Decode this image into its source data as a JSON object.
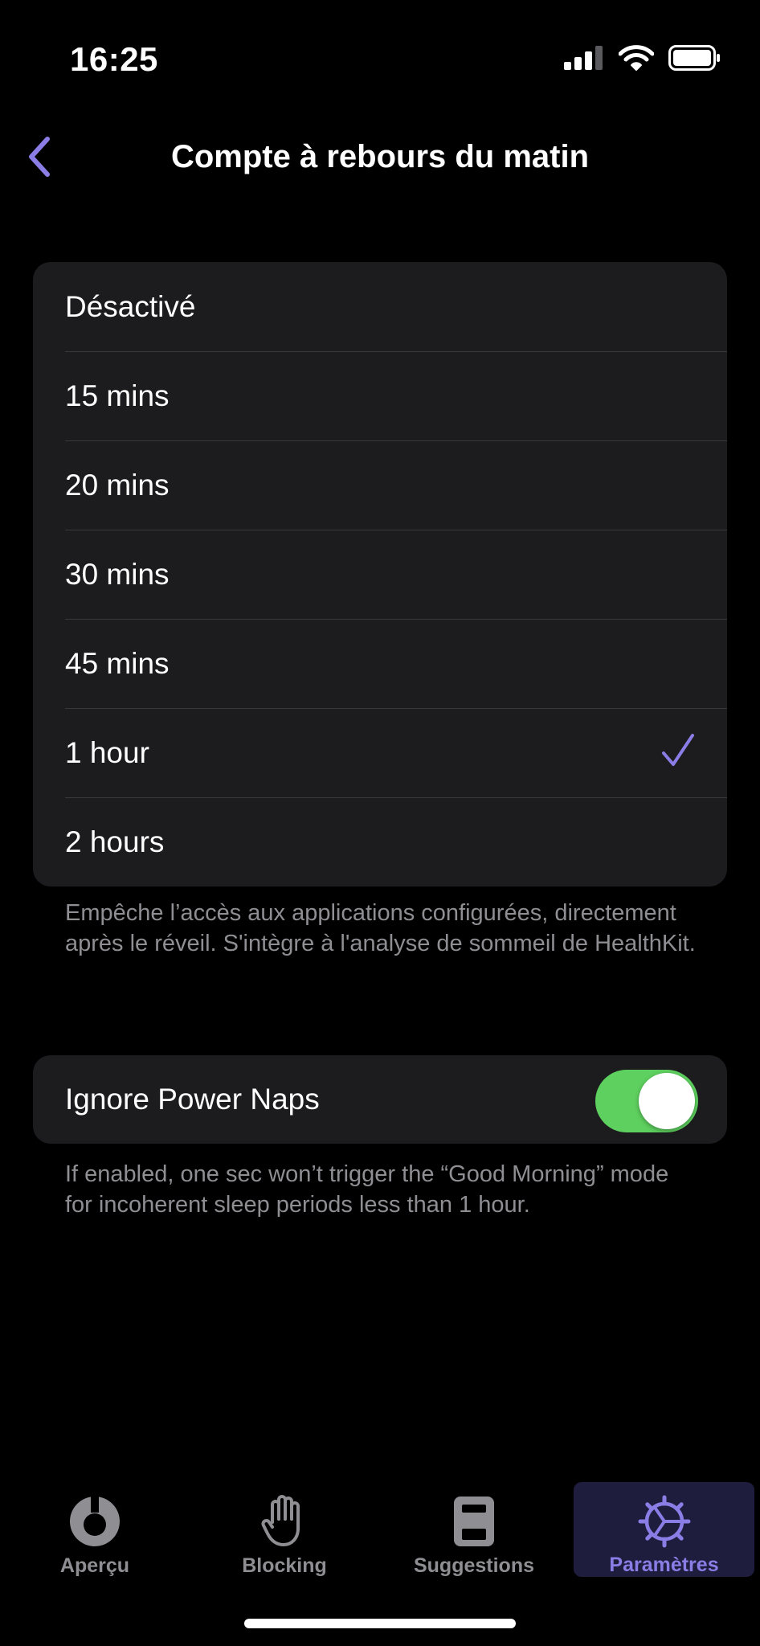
{
  "status_bar": {
    "time": "16:25"
  },
  "nav": {
    "title": "Compte à rebours du matin"
  },
  "options": [
    {
      "label": "Désactivé",
      "selected": false
    },
    {
      "label": "15 mins",
      "selected": false
    },
    {
      "label": "20 mins",
      "selected": false
    },
    {
      "label": "30 mins",
      "selected": false
    },
    {
      "label": "45 mins",
      "selected": false
    },
    {
      "label": "1 hour",
      "selected": true
    },
    {
      "label": "2 hours",
      "selected": false
    }
  ],
  "options_footnote": "Empêche l’accès aux applications configurées, directement après le réveil. S'intègre à l'analyse de sommeil de HealthKit.",
  "power_naps": {
    "label": "Ignore Power Naps",
    "enabled": true,
    "footnote": "If enabled, one sec won’t trigger the “Good Morning” mode for incoherent sleep periods less than 1 hour."
  },
  "tabs": [
    {
      "label": "Aperçu",
      "icon": "ring-icon"
    },
    {
      "label": "Blocking",
      "icon": "hand-icon"
    },
    {
      "label": "Suggestions",
      "icon": "book-icon"
    },
    {
      "label": "Paramètres",
      "icon": "gear-icon",
      "active": true
    }
  ],
  "colors": {
    "accent": "#8b7de6",
    "toggle_on": "#5ed05f",
    "card": "#1c1c1e",
    "secondary_text": "#8e8e93"
  }
}
